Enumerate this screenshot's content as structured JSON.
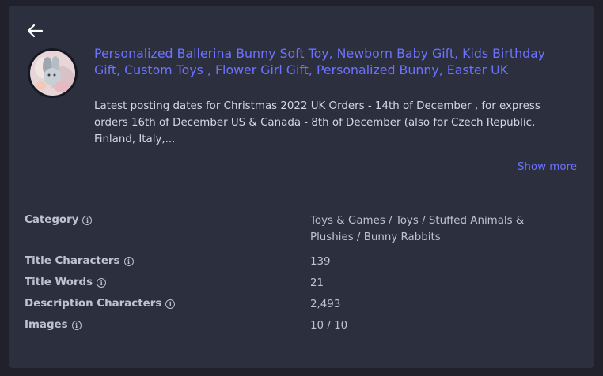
{
  "header": {
    "back_icon": "arrow-left-icon"
  },
  "product": {
    "title": "Personalized Ballerina Bunny Soft Toy, Newborn Baby Gift, Kids Birthday Gift, Custom Toys , Flower Girl Gift, Personalized Bunny, Easter UK",
    "description": "Latest posting dates for Christmas 2022 UK Orders - 14th of December , for express orders 16th of December US & Canada - 8th of December (also for Czech Republic, Finland, Italy,...",
    "show_more": "Show more",
    "thumbnail": "product-thumbnail"
  },
  "details": {
    "rows": [
      {
        "label": "Category",
        "value": "Toys & Games / Toys / Stuffed Animals & Plushies / Bunny Rabbits"
      },
      {
        "label": "Title Characters",
        "value": "139"
      },
      {
        "label": "Title Words",
        "value": "21"
      },
      {
        "label": "Description Characters",
        "value": "2,493"
      },
      {
        "label": "Images",
        "value": "10 / 10"
      }
    ],
    "info_icon": "info-icon",
    "info_glyph": "i"
  },
  "colors": {
    "background": "#20212b",
    "card": "#2c2f3e",
    "accent": "#6d73ff",
    "text": "#d4d6e2",
    "muted": "#bfc2d0"
  }
}
